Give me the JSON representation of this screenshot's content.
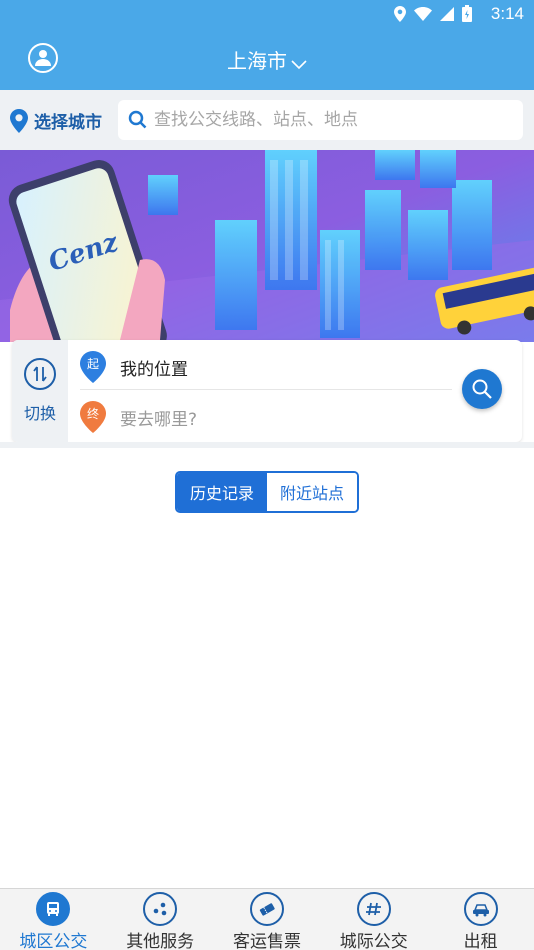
{
  "status_bar": {
    "time": "3:14"
  },
  "header": {
    "city": "上海市"
  },
  "search_row": {
    "pick_city_label": "选择城市",
    "search_placeholder": "查找公交线路、站点、地点"
  },
  "banner": {
    "logo_text": "Cenz"
  },
  "route": {
    "switch_label": "切换",
    "from_badge": "起",
    "to_badge": "终",
    "from_value": "我的位置",
    "to_placeholder": "要去哪里?"
  },
  "tabs": [
    {
      "label": "历史记录",
      "active": true
    },
    {
      "label": "附近站点",
      "active": false
    }
  ],
  "bottom_nav": [
    {
      "label": "城区公交",
      "icon": "bus-icon",
      "active": true
    },
    {
      "label": "其他服务",
      "icon": "services-icon",
      "active": false
    },
    {
      "label": "客运售票",
      "icon": "ticket-icon",
      "active": false
    },
    {
      "label": "城际公交",
      "icon": "intercity-icon",
      "active": false
    },
    {
      "label": "出租",
      "icon": "taxi-icon",
      "active": false
    }
  ],
  "colors": {
    "header_blue": "#4aa8e8",
    "accent_blue": "#1f78d1",
    "dark_blue": "#1e5fa8"
  }
}
